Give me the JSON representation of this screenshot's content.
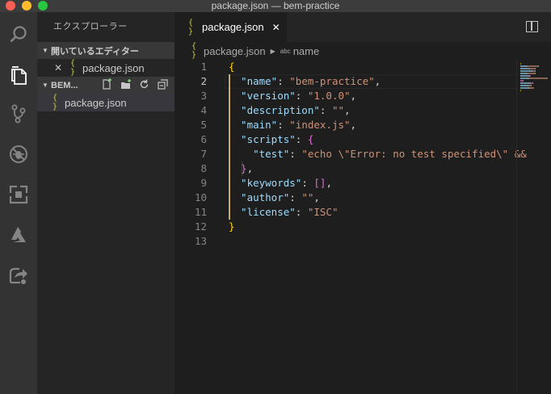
{
  "window": {
    "title": "package.json — bem-practice"
  },
  "activity_bar": {
    "icons": [
      "search-icon",
      "files-icon",
      "source-control-icon",
      "debug-icon",
      "extensions-icon",
      "azure-icon",
      "live-share-icon"
    ],
    "active": "files-icon"
  },
  "sidebar": {
    "title": "エクスプローラー",
    "open_editors": {
      "label": "開いているエディター",
      "items": [
        {
          "icon": "{ }",
          "name": "package.json",
          "close": "✕"
        }
      ]
    },
    "folder": {
      "label": "BEM...",
      "tools": [
        "new-file-icon",
        "new-folder-icon",
        "refresh-icon",
        "collapse-all-icon"
      ],
      "items": [
        {
          "icon": "{ }",
          "name": "package.json"
        }
      ]
    }
  },
  "editor": {
    "tab": {
      "icon": "{ }",
      "label": "package.json",
      "close": "✕"
    },
    "breadcrumb": {
      "file_icon": "{ }",
      "file": "package.json",
      "symbol_icon": "abc",
      "symbol": "name"
    },
    "active_line": 2,
    "lines": [
      {
        "n": "1",
        "tokens": [
          {
            "t": "{",
            "c": "b1"
          }
        ]
      },
      {
        "n": "2",
        "tokens": [
          {
            "t": "  \"name\"",
            "c": "k"
          },
          {
            "t": ": ",
            "c": "p"
          },
          {
            "t": "\"bem-practice\"",
            "c": "s"
          },
          {
            "t": ",",
            "c": "p"
          }
        ]
      },
      {
        "n": "3",
        "tokens": [
          {
            "t": "  \"version\"",
            "c": "k"
          },
          {
            "t": ": ",
            "c": "p"
          },
          {
            "t": "\"1.0.0\"",
            "c": "s"
          },
          {
            "t": ",",
            "c": "p"
          }
        ]
      },
      {
        "n": "4",
        "tokens": [
          {
            "t": "  \"description\"",
            "c": "k"
          },
          {
            "t": ": ",
            "c": "p"
          },
          {
            "t": "\"\"",
            "c": "s"
          },
          {
            "t": ",",
            "c": "p"
          }
        ]
      },
      {
        "n": "5",
        "tokens": [
          {
            "t": "  \"main\"",
            "c": "k"
          },
          {
            "t": ": ",
            "c": "p"
          },
          {
            "t": "\"index.js\"",
            "c": "s"
          },
          {
            "t": ",",
            "c": "p"
          }
        ]
      },
      {
        "n": "6",
        "tokens": [
          {
            "t": "  \"scripts\"",
            "c": "k"
          },
          {
            "t": ": ",
            "c": "p"
          },
          {
            "t": "{",
            "c": "b2"
          }
        ]
      },
      {
        "n": "7",
        "tokens": [
          {
            "t": "    \"test\"",
            "c": "k"
          },
          {
            "t": ": ",
            "c": "p"
          },
          {
            "t": "\"echo \\\"Error: no test specified\\\" &&",
            "c": "s"
          }
        ]
      },
      {
        "n": "8",
        "tokens": [
          {
            "t": "  }",
            "c": "b2"
          },
          {
            "t": ",",
            "c": "p"
          }
        ]
      },
      {
        "n": "9",
        "tokens": [
          {
            "t": "  \"keywords\"",
            "c": "k"
          },
          {
            "t": ": ",
            "c": "p"
          },
          {
            "t": "[]",
            "c": "b2"
          },
          {
            "t": ",",
            "c": "p"
          }
        ]
      },
      {
        "n": "10",
        "tokens": [
          {
            "t": "  \"author\"",
            "c": "k"
          },
          {
            "t": ": ",
            "c": "p"
          },
          {
            "t": "\"\"",
            "c": "s"
          },
          {
            "t": ",",
            "c": "p"
          }
        ]
      },
      {
        "n": "11",
        "tokens": [
          {
            "t": "  \"license\"",
            "c": "k"
          },
          {
            "t": ": ",
            "c": "p"
          },
          {
            "t": "\"ISC\"",
            "c": "s"
          }
        ]
      },
      {
        "n": "12",
        "tokens": [
          {
            "t": "}",
            "c": "b1"
          }
        ]
      },
      {
        "n": "13",
        "tokens": []
      }
    ]
  },
  "colors": {
    "key": "#9cdcfe",
    "string": "#ce9178",
    "bracket_level1": "#ffd700",
    "bracket_level2": "#da70d6",
    "json_icon": "#cbcb41"
  }
}
